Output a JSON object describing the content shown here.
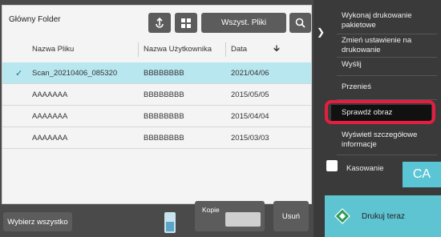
{
  "folder": {
    "title": "Główny Folder"
  },
  "toolbar": {
    "all_files_label": "Wszyst. Pliki"
  },
  "table": {
    "headers": {
      "file": "Nazwa Pliku",
      "user": "Nazwa Użytkownika",
      "date": "Data"
    },
    "rows": [
      {
        "file": "Scan_20210406_085320",
        "user": "BBBBBBBB",
        "date": "2021/04/06",
        "selected": true
      },
      {
        "file": "AAAAAAA",
        "user": "BBBBBBBB",
        "date": "2015/05/05",
        "selected": false
      },
      {
        "file": "AAAAAAA",
        "user": "BBBBBBBB",
        "date": "2015/04/04",
        "selected": false
      },
      {
        "file": "AAAAAAA",
        "user": "BBBBBBBB",
        "date": "2015/03/03",
        "selected": false
      }
    ]
  },
  "bottom": {
    "select_all": "Wybierz wszystko",
    "copies": "Kopie",
    "delete": "Usuń"
  },
  "menu": {
    "items": [
      "Wykonaj drukowanie pakietowe",
      "Zmień ustawienie na drukowanie",
      "Wyślij",
      "Przenieś",
      "Sprawdź obraz",
      "Wyświetl szczegółowe informacje"
    ]
  },
  "erase": {
    "label": "Kasowanie"
  },
  "ca": {
    "label": "CA"
  },
  "print": {
    "label": "Drukuj teraz"
  },
  "colors": {
    "accent": "#5fc4d2",
    "highlight": "#e41e3f",
    "selected_row": "#b9e7f0"
  }
}
